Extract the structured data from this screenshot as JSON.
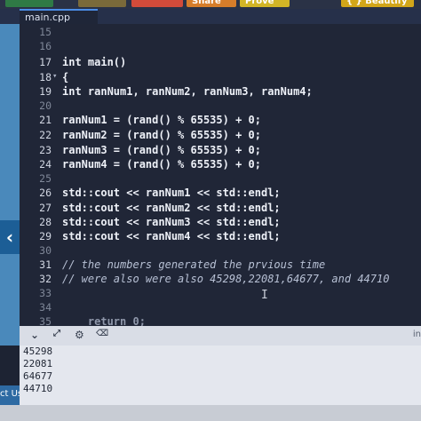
{
  "toolbar": {
    "buttons": [
      "",
      "",
      "",
      "Share",
      "Prove",
      "{ } Beautify"
    ],
    "colors": [
      "#2f7a45",
      "#7a6a3a",
      "#d24b3a",
      "#d67d2a",
      "#d2b526",
      "#d2a619"
    ]
  },
  "tab": {
    "label": "main.cpp"
  },
  "editor": {
    "lines": [
      {
        "num": "15",
        "text": ""
      },
      {
        "num": "16",
        "text": ""
      },
      {
        "num": "17",
        "text": "int main()"
      },
      {
        "num": "18",
        "text": "{"
      },
      {
        "num": "19",
        "text": "int ranNum1, ranNum2, ranNum3, ranNum4;"
      },
      {
        "num": "20",
        "text": ""
      },
      {
        "num": "21",
        "text": "ranNum1 = (rand() % 65535) + 0;"
      },
      {
        "num": "22",
        "text": "ranNum2 = (rand() % 65535) + 0;"
      },
      {
        "num": "23",
        "text": "ranNum3 = (rand() % 65535) + 0;"
      },
      {
        "num": "24",
        "text": "ranNum4 = (rand() % 65535) + 0;"
      },
      {
        "num": "25",
        "text": ""
      },
      {
        "num": "26",
        "text": "std::cout << ranNum1 << std::endl;"
      },
      {
        "num": "27",
        "text": "std::cout << ranNum2 << std::endl;"
      },
      {
        "num": "28",
        "text": "std::cout << ranNum3 << std::endl;"
      },
      {
        "num": "29",
        "text": "std::cout << ranNum4 << std::endl;"
      },
      {
        "num": "30",
        "text": ""
      },
      {
        "num": "31",
        "text": "// the numbers generated the prvious time"
      },
      {
        "num": "32",
        "text": "// were also were also 45298,22081,64677, and 44710"
      },
      {
        "num": "33",
        "text": ""
      },
      {
        "num": "34",
        "text": ""
      },
      {
        "num": "35",
        "text": "    return 0;"
      }
    ]
  },
  "output_toolbar": {
    "right_label": "in"
  },
  "output": {
    "lines": [
      "45298",
      "22081",
      "64677",
      "44710"
    ]
  },
  "footer": {
    "left_label": "ct Us"
  },
  "colors": {
    "accent": "#4a89bb",
    "editor_bg": "#202637",
    "comment": "#b7c0d4",
    "operator": "#f0a96b"
  }
}
